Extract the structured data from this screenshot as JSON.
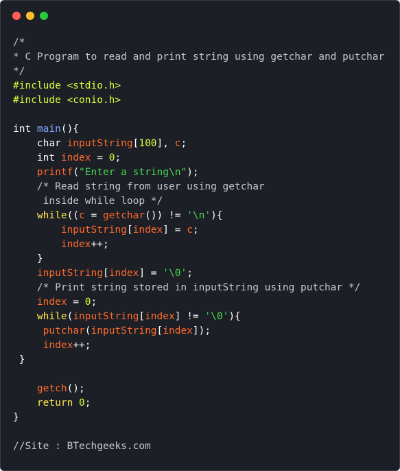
{
  "window": {
    "background": "#1d1f27",
    "controls": [
      {
        "name": "close-dot",
        "color": "#ff5f56"
      },
      {
        "name": "minimize-dot",
        "color": "#ffbd2e"
      },
      {
        "name": "maximize-dot",
        "color": "#27c93f"
      }
    ]
  },
  "theme": {
    "comment": "#c8c8c8",
    "preprocessor": "#d4ff3a",
    "keyword": "#ffe84d",
    "identifier": "#ff6a2a",
    "function": "#ff6a2a",
    "string": "#46d850",
    "number": "#d4ff3a",
    "plain": "#ffffff"
  },
  "code": {
    "lines": [
      [
        {
          "t": "/*",
          "c": "comment"
        }
      ],
      [
        {
          "t": "* C Program to read and print string using getchar and putchar",
          "c": "comment"
        }
      ],
      [
        {
          "t": "*/",
          "c": "comment"
        }
      ],
      [
        {
          "t": "#include <stdio.h>",
          "c": "preprocessor"
        }
      ],
      [
        {
          "t": "#include <conio.h>",
          "c": "preprocessor"
        }
      ],
      [],
      [
        {
          "t": "int ",
          "c": "plain"
        },
        {
          "t": "main",
          "c": "func_blue"
        },
        {
          "t": "(){",
          "c": "plain"
        }
      ],
      [
        {
          "t": "    char ",
          "c": "plain"
        },
        {
          "t": "inputString",
          "c": "identifier"
        },
        {
          "t": "[",
          "c": "plain"
        },
        {
          "t": "100",
          "c": "number"
        },
        {
          "t": "], ",
          "c": "plain"
        },
        {
          "t": "c",
          "c": "identifier"
        },
        {
          "t": ";",
          "c": "plain"
        }
      ],
      [
        {
          "t": "    int ",
          "c": "plain"
        },
        {
          "t": "index",
          "c": "identifier"
        },
        {
          "t": " = ",
          "c": "plain"
        },
        {
          "t": "0",
          "c": "number"
        },
        {
          "t": ";",
          "c": "plain"
        }
      ],
      [
        {
          "t": "    ",
          "c": "plain"
        },
        {
          "t": "printf",
          "c": "function"
        },
        {
          "t": "(",
          "c": "plain"
        },
        {
          "t": "\"Enter a string\\n\"",
          "c": "string"
        },
        {
          "t": ");",
          "c": "plain"
        }
      ],
      [
        {
          "t": "    /* Read string from user using getchar",
          "c": "comment"
        }
      ],
      [
        {
          "t": "     inside while loop */",
          "c": "comment"
        }
      ],
      [
        {
          "t": "    ",
          "c": "plain"
        },
        {
          "t": "while",
          "c": "keyword"
        },
        {
          "t": "((",
          "c": "plain"
        },
        {
          "t": "c",
          "c": "identifier"
        },
        {
          "t": " = ",
          "c": "plain"
        },
        {
          "t": "getchar",
          "c": "function"
        },
        {
          "t": "()) != ",
          "c": "plain"
        },
        {
          "t": "'\\n'",
          "c": "string"
        },
        {
          "t": "){",
          "c": "plain"
        }
      ],
      [
        {
          "t": "        ",
          "c": "plain"
        },
        {
          "t": "inputString",
          "c": "identifier"
        },
        {
          "t": "[",
          "c": "plain"
        },
        {
          "t": "index",
          "c": "identifier"
        },
        {
          "t": "] = ",
          "c": "plain"
        },
        {
          "t": "c",
          "c": "identifier"
        },
        {
          "t": ";",
          "c": "plain"
        }
      ],
      [
        {
          "t": "        ",
          "c": "plain"
        },
        {
          "t": "index",
          "c": "identifier"
        },
        {
          "t": "++;",
          "c": "plain"
        }
      ],
      [
        {
          "t": "    }",
          "c": "plain"
        }
      ],
      [
        {
          "t": "    ",
          "c": "plain"
        },
        {
          "t": "inputString",
          "c": "identifier"
        },
        {
          "t": "[",
          "c": "plain"
        },
        {
          "t": "index",
          "c": "identifier"
        },
        {
          "t": "] = ",
          "c": "plain"
        },
        {
          "t": "'\\0'",
          "c": "string"
        },
        {
          "t": ";",
          "c": "plain"
        }
      ],
      [
        {
          "t": "    /* Print string stored in inputString using putchar */",
          "c": "comment"
        }
      ],
      [
        {
          "t": "    ",
          "c": "plain"
        },
        {
          "t": "index",
          "c": "identifier"
        },
        {
          "t": " = ",
          "c": "plain"
        },
        {
          "t": "0",
          "c": "number"
        },
        {
          "t": ";",
          "c": "plain"
        }
      ],
      [
        {
          "t": "    ",
          "c": "plain"
        },
        {
          "t": "while",
          "c": "keyword"
        },
        {
          "t": "(",
          "c": "plain"
        },
        {
          "t": "inputString",
          "c": "identifier"
        },
        {
          "t": "[",
          "c": "plain"
        },
        {
          "t": "index",
          "c": "identifier"
        },
        {
          "t": "] != ",
          "c": "plain"
        },
        {
          "t": "'\\0'",
          "c": "string"
        },
        {
          "t": "){",
          "c": "plain"
        }
      ],
      [
        {
          "t": "     ",
          "c": "plain"
        },
        {
          "t": "putchar",
          "c": "function"
        },
        {
          "t": "(",
          "c": "plain"
        },
        {
          "t": "inputString",
          "c": "identifier"
        },
        {
          "t": "[",
          "c": "plain"
        },
        {
          "t": "index",
          "c": "identifier"
        },
        {
          "t": "]);",
          "c": "plain"
        }
      ],
      [
        {
          "t": "     ",
          "c": "plain"
        },
        {
          "t": "index",
          "c": "identifier"
        },
        {
          "t": "++;",
          "c": "plain"
        }
      ],
      [
        {
          "t": " }",
          "c": "plain"
        }
      ],
      [],
      [
        {
          "t": "    ",
          "c": "plain"
        },
        {
          "t": "getch",
          "c": "function"
        },
        {
          "t": "();",
          "c": "plain"
        }
      ],
      [
        {
          "t": "    ",
          "c": "plain"
        },
        {
          "t": "return",
          "c": "keyword"
        },
        {
          "t": " ",
          "c": "plain"
        },
        {
          "t": "0",
          "c": "number"
        },
        {
          "t": ";",
          "c": "plain"
        }
      ],
      [
        {
          "t": "}",
          "c": "plain"
        }
      ],
      [],
      [
        {
          "t": "//Site : BTechgeeks.com",
          "c": "comment"
        }
      ]
    ]
  }
}
